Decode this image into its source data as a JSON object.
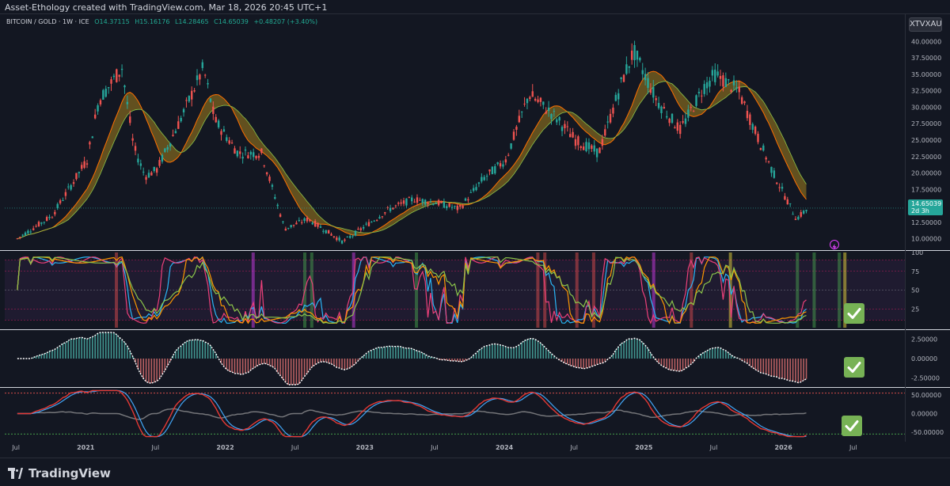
{
  "header": {
    "attribution": "Asset-Ethology created with TradingView.com, Mar 18, 2026 20:45 UTC+1"
  },
  "legend": {
    "symbol": "BITCOIN / GOLD · 1W · ICE",
    "open": "O14.37115",
    "high": "H15.16176",
    "low": "L14.28465",
    "close": "C14.65039",
    "change": "+0.48207 (+3.40%)"
  },
  "symbol_button": "XTVXAU",
  "last_price": {
    "value": "14.65039",
    "countdown": "2d 3h"
  },
  "branding": {
    "name": "TradingView"
  },
  "colors": {
    "background": "#131722",
    "up": "#26a69a",
    "down": "#ef5350",
    "ribbon_fast": "#ff6f00",
    "ribbon_slow": "#8bc34a",
    "check": "#77b255"
  },
  "chart_data": [
    {
      "type": "candlestick",
      "title": "BITCOIN / GOLD",
      "interval": "1W",
      "y_axis_labels": [
        "40.00000",
        "37.50000",
        "35.00000",
        "32.50000",
        "30.00000",
        "27.50000",
        "25.00000",
        "22.50000",
        "20.00000",
        "17.50000",
        "12.50000",
        "10.00000"
      ],
      "ylim": [
        8.5,
        41.5
      ],
      "x_axis_labels": [
        "Jul",
        "2021",
        "Jul",
        "2022",
        "Jul",
        "2023",
        "Jul",
        "2024",
        "Jul",
        "2025",
        "Jul",
        "2026",
        "Jul"
      ],
      "close_path": [
        {
          "t": "2020-07",
          "c": 10.0
        },
        {
          "t": "2020-10",
          "c": 13.5
        },
        {
          "t": "2021-01",
          "c": 22.0
        },
        {
          "t": "2021-02",
          "c": 31.0
        },
        {
          "t": "2021-04",
          "c": 36.0
        },
        {
          "t": "2021-05",
          "c": 24.0
        },
        {
          "t": "2021-06",
          "c": 19.5
        },
        {
          "t": "2021-07",
          "c": 20.5
        },
        {
          "t": "2021-09",
          "c": 28.0
        },
        {
          "t": "2021-11",
          "c": 36.0
        },
        {
          "t": "2021-12",
          "c": 28.0
        },
        {
          "t": "2022-02",
          "c": 23.0
        },
        {
          "t": "2022-04",
          "c": 23.0
        },
        {
          "t": "2022-06",
          "c": 11.5
        },
        {
          "t": "2022-08",
          "c": 13.0
        },
        {
          "t": "2022-11",
          "c": 9.5
        },
        {
          "t": "2023-01",
          "c": 12.0
        },
        {
          "t": "2023-03",
          "c": 14.5
        },
        {
          "t": "2023-05",
          "c": 16.0
        },
        {
          "t": "2023-07",
          "c": 15.5
        },
        {
          "t": "2023-09",
          "c": 14.5
        },
        {
          "t": "2023-11",
          "c": 19.0
        },
        {
          "t": "2024-01",
          "c": 22.0
        },
        {
          "t": "2024-03",
          "c": 32.0
        },
        {
          "t": "2024-05",
          "c": 29.0
        },
        {
          "t": "2024-07",
          "c": 25.0
        },
        {
          "t": "2024-09",
          "c": 23.0
        },
        {
          "t": "2024-11",
          "c": 34.0
        },
        {
          "t": "2024-12",
          "c": 38.5
        },
        {
          "t": "2025-02",
          "c": 31.0
        },
        {
          "t": "2025-04",
          "c": 26.5
        },
        {
          "t": "2025-06",
          "c": 33.0
        },
        {
          "t": "2025-07",
          "c": 35.0
        },
        {
          "t": "2025-09",
          "c": 32.5
        },
        {
          "t": "2025-11",
          "c": 24.0
        },
        {
          "t": "2025-12",
          "c": 20.0
        },
        {
          "t": "2026-02",
          "c": 13.0
        },
        {
          "t": "2026-03",
          "c": 14.65039
        }
      ]
    },
    {
      "type": "line",
      "title": "",
      "y_axis_labels": [
        "100",
        "75",
        "50",
        "25"
      ],
      "ylim": [
        0,
        100
      ]
    },
    {
      "type": "area",
      "title": "",
      "y_axis_labels": [
        "2.50000",
        "0.00000",
        "-2.50000"
      ],
      "ylim": [
        -3.5,
        3.5
      ]
    },
    {
      "type": "line",
      "title": "",
      "y_axis_labels": [
        "50.00000",
        "0.00000",
        "-50.00000"
      ],
      "ylim": [
        -65,
        65
      ]
    }
  ]
}
